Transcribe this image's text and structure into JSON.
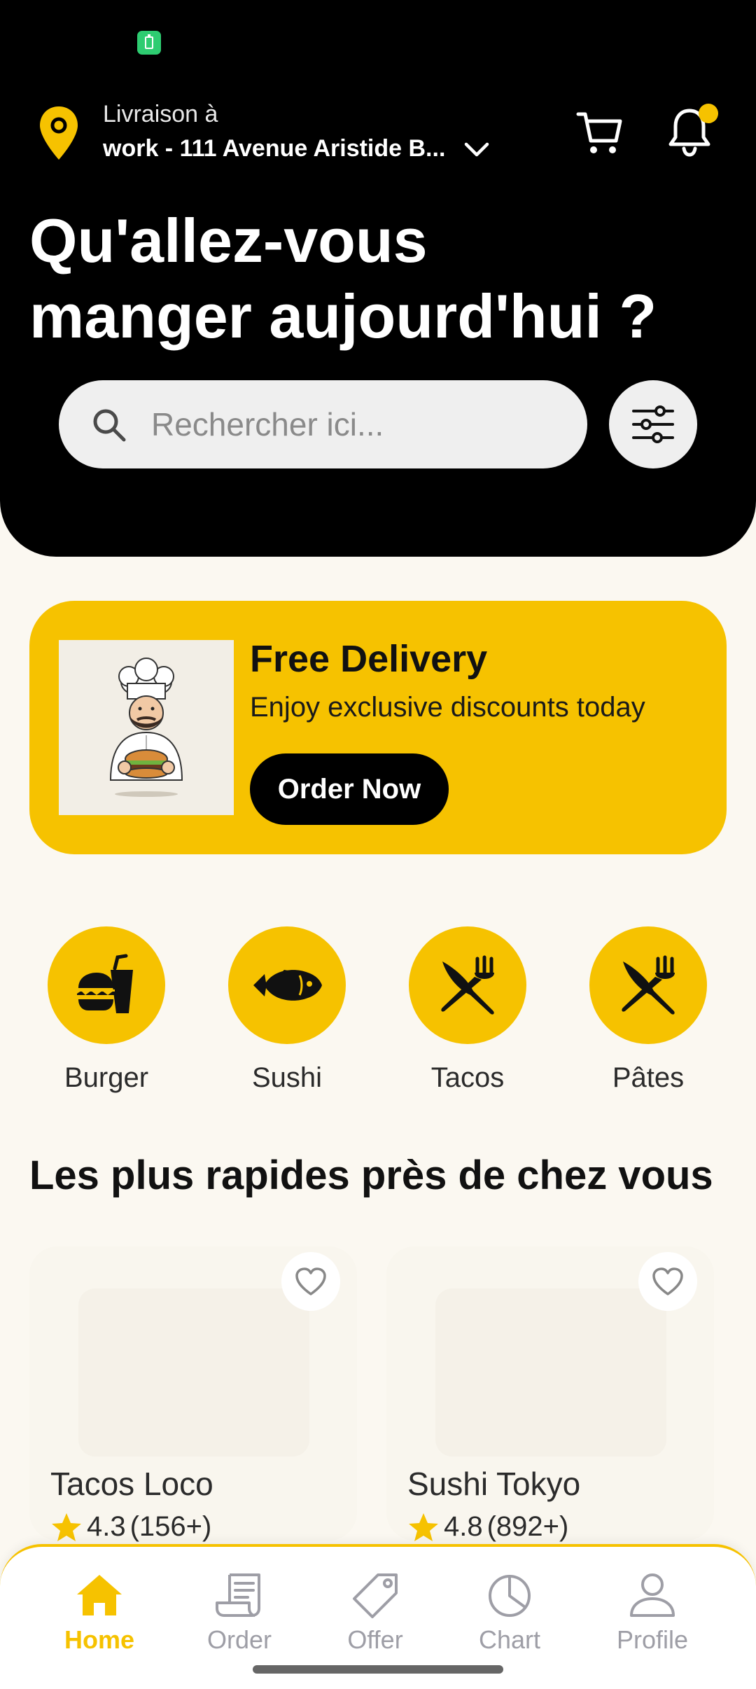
{
  "location": {
    "label": "Livraison à",
    "address": "work - 111 Avenue Aristide B..."
  },
  "headline": {
    "line1": "Qu'allez-vous",
    "line2": "manger aujourd'hui ?"
  },
  "search": {
    "placeholder": "Rechercher ici..."
  },
  "promo": {
    "title": "Free Delivery",
    "subtitle": "Enjoy exclusive discounts today",
    "button_label": "Order Now"
  },
  "categories": [
    {
      "label": "Burger",
      "icon": "burger-drink-icon"
    },
    {
      "label": "Sushi",
      "icon": "fish-icon"
    },
    {
      "label": "Tacos",
      "icon": "utensils-crossed-icon"
    },
    {
      "label": "Pâtes",
      "icon": "utensils-crossed-icon"
    }
  ],
  "section": {
    "title": "Les plus rapides près de chez vous"
  },
  "restaurants": [
    {
      "name": "Tacos Loco",
      "rating": "4.3",
      "reviews": "(156+)"
    },
    {
      "name": "Sushi Tokyo",
      "rating": "4.8",
      "reviews": "(892+)"
    }
  ],
  "nav": [
    {
      "label": "Home",
      "icon": "home-icon",
      "active": true
    },
    {
      "label": "Order",
      "icon": "receipt-icon",
      "active": false
    },
    {
      "label": "Offer",
      "icon": "tag-icon",
      "active": false
    },
    {
      "label": "Chart",
      "icon": "pie-chart-icon",
      "active": false
    },
    {
      "label": "Profile",
      "icon": "user-icon",
      "active": false
    }
  ],
  "colors": {
    "accent": "#f6c200",
    "header_bg": "#000000",
    "page_bg": "#fbf8f1",
    "nav_inactive": "#9e9ea6"
  }
}
